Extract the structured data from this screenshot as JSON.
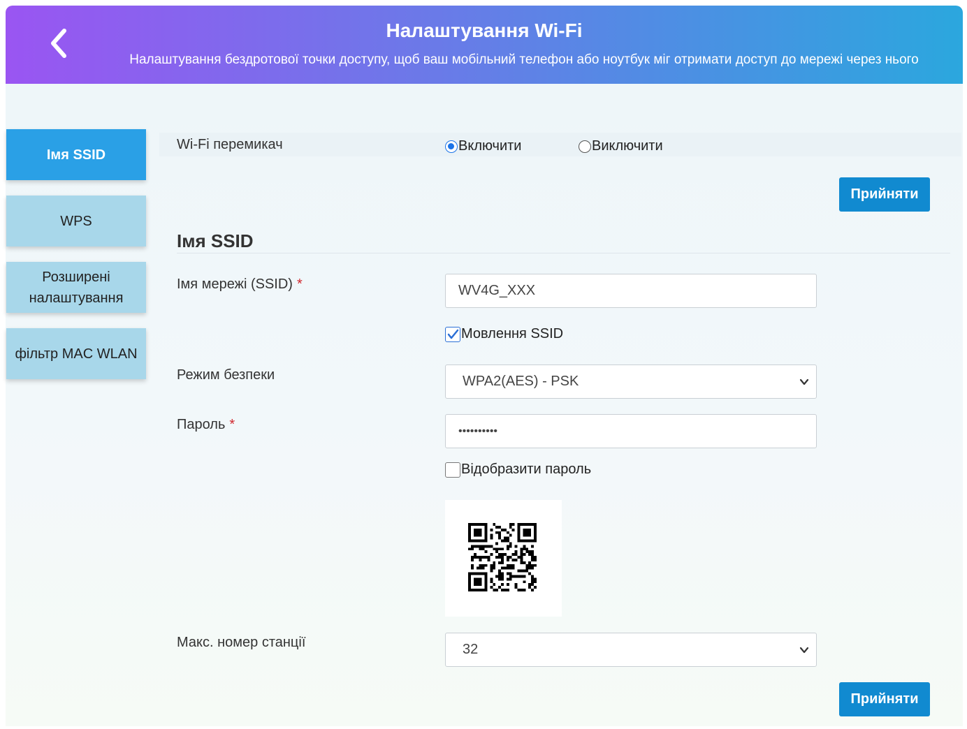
{
  "header": {
    "title": "Налаштування Wi-Fi",
    "subtitle": "Налаштування бездротової точки доступу, щоб ваш мобільний телефон або ноутбук міг отримати доступ до мережі через нього",
    "back_icon": "chevron-left-icon"
  },
  "sidebar": {
    "items": [
      {
        "label": "Імя SSID",
        "active": true
      },
      {
        "label": "WPS",
        "active": false
      },
      {
        "label": "Розширені налаштування",
        "active": false
      },
      {
        "label": "фільтр MAC WLAN",
        "active": false
      }
    ]
  },
  "wifi_switch": {
    "label": "Wi-Fi перемикач",
    "options": [
      "Включити",
      "Виключити"
    ],
    "selected": "Включити"
  },
  "apply_label": "Прийняти",
  "ssid_section": {
    "title": "Імя SSID",
    "network_name_label": "Імя мережі (SSID)",
    "required_mark": "*",
    "network_name_value": "WV4G_XXX",
    "broadcast_label": "Мовлення SSID",
    "broadcast_checked": true,
    "security_label": "Режим безпеки",
    "security_value": "WPA2(AES) - PSK",
    "password_label": "Пароль",
    "password_value": "••••••••••",
    "show_password_label": "Відобразити пароль",
    "show_password_checked": false,
    "max_station_label": "Макс. номер станції",
    "max_station_value": "32"
  },
  "colors": {
    "header_gradient_start": "#9a55f2",
    "header_gradient_end": "#2ba7de",
    "nav_active": "#2aa0e6",
    "nav_inactive": "#a8d7ea",
    "button": "#118ad0",
    "required": "#d0282e"
  }
}
